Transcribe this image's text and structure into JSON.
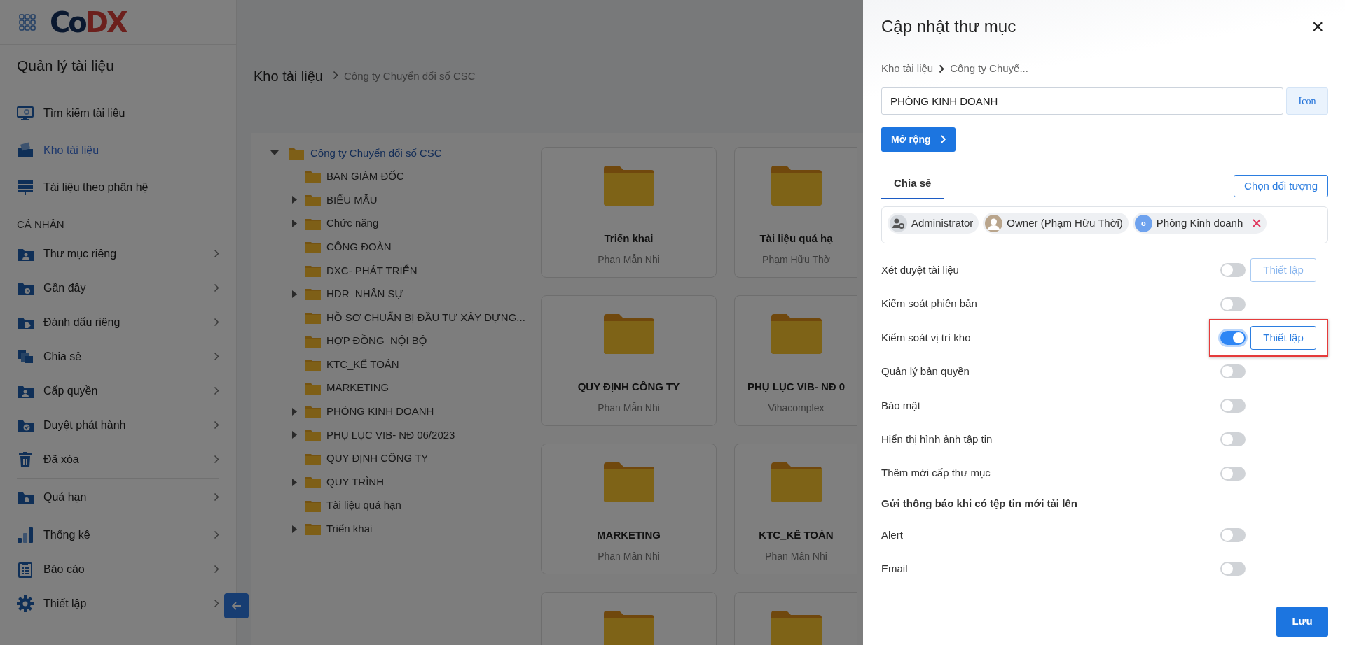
{
  "app": {
    "logo": {
      "part_1": "Co",
      "part_2": "DX"
    }
  },
  "sidebar": {
    "title": "Quản lý tài liệu",
    "sections": [
      {
        "items": [
          {
            "label": "Tìm kiếm tài liệu",
            "selected": false,
            "expandable": false
          },
          {
            "label": "Kho tài liệu",
            "selected": true,
            "expandable": false
          },
          {
            "label": "Tài liệu theo phân hệ",
            "selected": false,
            "expandable": false
          }
        ]
      },
      {
        "heading": "CÁ NHÂN",
        "items": [
          {
            "label": "Thư mục riêng",
            "selected": false,
            "expandable": true
          },
          {
            "label": "Gần đây",
            "selected": false,
            "expandable": true
          },
          {
            "label": "Đánh dấu riêng",
            "selected": false,
            "expandable": true
          },
          {
            "label": "Chia sẻ",
            "selected": false,
            "expandable": true
          },
          {
            "label": "Cấp quyền",
            "selected": false,
            "expandable": true
          },
          {
            "label": "Duyệt phát hành",
            "selected": false,
            "expandable": true
          },
          {
            "label": "Đã xóa",
            "selected": false,
            "expandable": true
          }
        ]
      },
      {
        "items": [
          {
            "label": "Quá hạn",
            "selected": false,
            "expandable": true
          }
        ]
      },
      {
        "items": [
          {
            "label": "Thống kê",
            "selected": false,
            "expandable": true
          },
          {
            "label": "Báo cáo",
            "selected": false,
            "expandable": true
          },
          {
            "label": "Thiết lập",
            "selected": false,
            "expandable": true
          }
        ]
      }
    ]
  },
  "main": {
    "title": "Kho tài liệu",
    "breadcrumb": "Công ty Chuyển đổi số CSC",
    "tree": {
      "label": "Công ty Chuyển đổi số CSC",
      "expanded": true,
      "selected": true,
      "children": [
        {
          "label": "BAN GIÁM ĐỐC",
          "expandable": false
        },
        {
          "label": "BIỂU MẪU",
          "expandable": true
        },
        {
          "label": "Chức năng",
          "expandable": true
        },
        {
          "label": "CÔNG ĐOÀN",
          "expandable": false
        },
        {
          "label": "DXC- PHÁT TRIỂN",
          "expandable": false
        },
        {
          "label": "HDR_NHÂN SỰ",
          "expandable": true
        },
        {
          "label": "HỒ SƠ CHUẨN BỊ ĐẦU TƯ XÂY DỰNG...",
          "expandable": false
        },
        {
          "label": "HỢP ĐỒNG_NỘI BỘ",
          "expandable": false
        },
        {
          "label": "KTC_KẾ TOÁN",
          "expandable": false
        },
        {
          "label": "MARKETING",
          "expandable": false
        },
        {
          "label": "PHÒNG KINH DOANH",
          "expandable": true
        },
        {
          "label": "PHỤ LỤC VIB- NĐ 06/2023",
          "expandable": true
        },
        {
          "label": "QUY ĐỊNH CÔNG TY",
          "expandable": false
        },
        {
          "label": "QUY TRÌNH",
          "expandable": true
        },
        {
          "label": "Tài liệu quá hạn",
          "expandable": false
        },
        {
          "label": "Triển khai",
          "expandable": true
        }
      ]
    },
    "cards": [
      {
        "kind": "folder",
        "name": "Triển khai",
        "author": "Phan Mẫn Nhi"
      },
      {
        "kind": "folder",
        "name": "Tài liệu quá hạ",
        "author": "Phạm Hữu Thờ"
      },
      {
        "kind": "folder",
        "name": "QUY ĐỊNH CÔNG TY",
        "author": "Phan Mẫn Nhi"
      },
      {
        "kind": "folder",
        "name": "PHỤ LỤC VIB- NĐ 0",
        "author": "Vihacomplex"
      },
      {
        "kind": "folder",
        "name": "MARKETING",
        "author": "Phan Mẫn Nhi"
      },
      {
        "kind": "folder",
        "name": "KTC_KẾ TOÁN",
        "author": "Phan Mẫn Nhi"
      },
      {
        "kind": "folder"
      },
      {
        "kind": "folder"
      }
    ]
  },
  "panel": {
    "title": "Cập nhật thư mục",
    "close": "×",
    "breadcrumb": [
      "Kho tài liệu",
      "Công ty Chuyể..."
    ],
    "name_field": {
      "value": "PHÒNG KINH DOANH"
    },
    "icon_button": "Icon",
    "expand_button": "Mở rộng",
    "tabs": [
      {
        "label": "Chia sẻ",
        "selected": true
      }
    ],
    "choose_button": "Chọn đối tượng",
    "shares": [
      {
        "kind": "role",
        "label": "Administrator",
        "removable": false
      },
      {
        "kind": "photo",
        "label": "Owner (Phạm Hữu Thời)",
        "removable": false
      },
      {
        "kind": "initial",
        "initial": "o",
        "label": "Phòng Kinh doanh",
        "removable": true
      }
    ],
    "settings": [
      {
        "kind": "toggle",
        "label": "Xét duyệt tài liệu",
        "on": false,
        "setup": {
          "label": "Thiết lập",
          "disabled": true
        },
        "highlighted": false
      },
      {
        "kind": "toggle",
        "label": "Kiểm soát phiên bản",
        "on": false,
        "highlighted": false
      },
      {
        "kind": "toggle",
        "label": "Kiểm soát vị trí kho",
        "on": true,
        "setup": {
          "label": "Thiết lập",
          "disabled": false
        },
        "highlighted": true
      },
      {
        "kind": "toggle",
        "label": "Quản lý bản quyền",
        "on": false,
        "highlighted": false
      },
      {
        "kind": "toggle",
        "label": "Bảo mật",
        "on": false,
        "highlighted": false
      },
      {
        "kind": "toggle",
        "label": "Hiển thị hình ảnh tập tin",
        "on": false,
        "highlighted": false
      },
      {
        "kind": "toggle",
        "label": "Thêm mới cấp thư mục",
        "on": false,
        "highlighted": false
      },
      {
        "kind": "heading",
        "label": "Gửi thông báo khi có tệp tin mới tải lên"
      },
      {
        "kind": "toggle",
        "label": "Alert",
        "on": false,
        "highlighted": false
      },
      {
        "kind": "toggle",
        "label": "Email",
        "on": false,
        "highlighted": false
      }
    ],
    "save_button": "Lưu"
  }
}
